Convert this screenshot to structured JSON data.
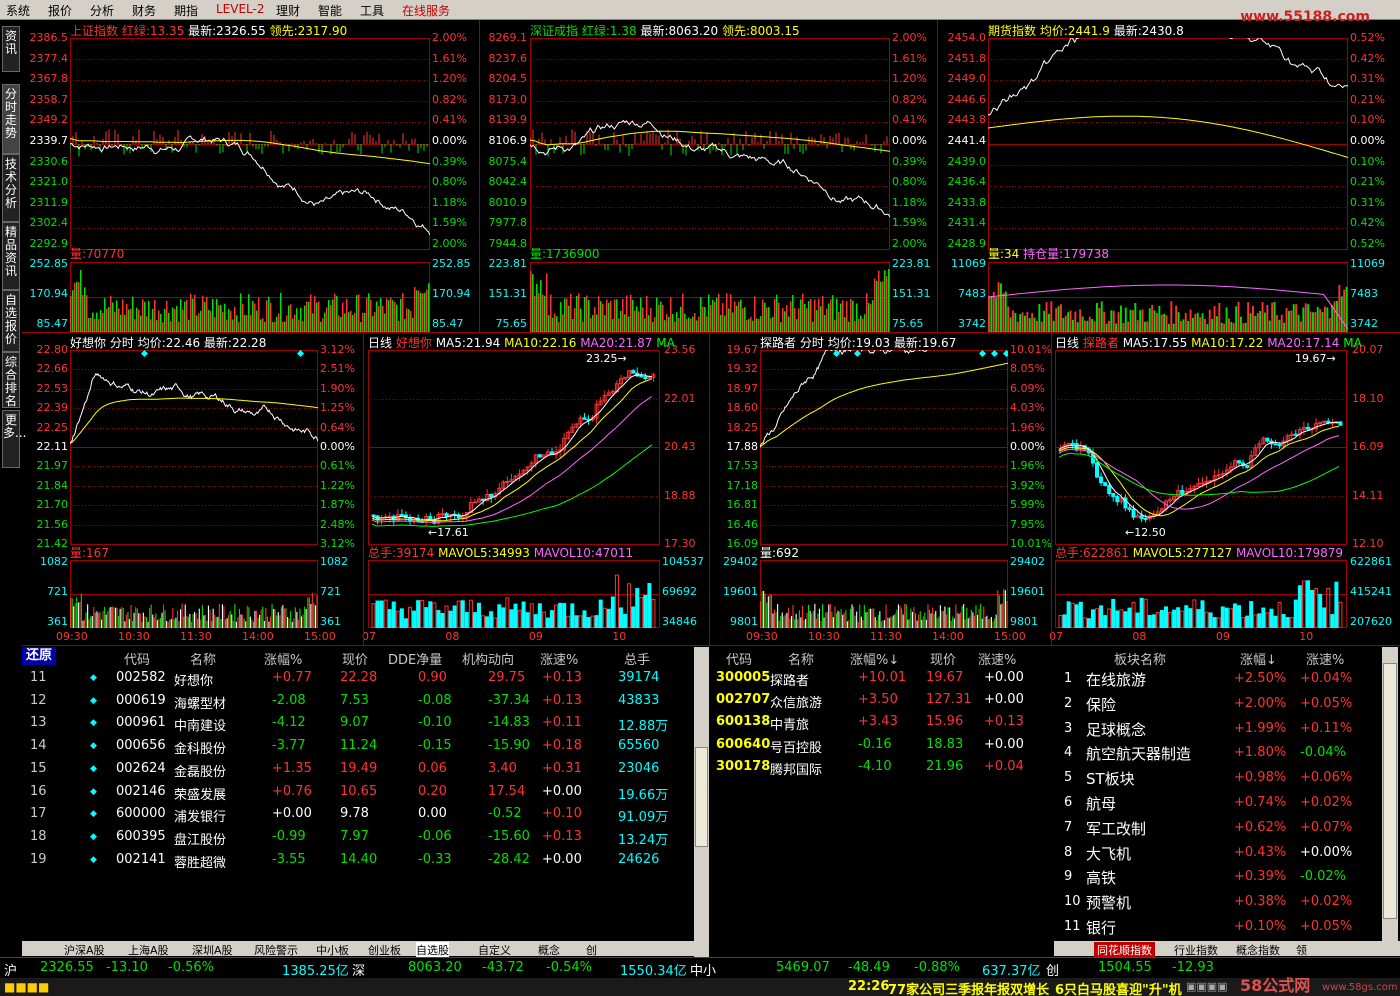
{
  "menu": [
    "系统",
    "报价",
    "分析",
    "财务",
    "期指",
    "LEVEL-2",
    "理财",
    "智能",
    "工具",
    "在线服务"
  ],
  "logo_text": "www.55188.com",
  "left_tabs": [
    "资讯",
    "分时走势",
    "技术分析",
    "精品资讯",
    "自选报价",
    "综合排名",
    "更多..."
  ],
  "colors": {
    "up": "#ff3232",
    "down": "#00e000",
    "axis": "#c00000",
    "white": "#ffffff",
    "yellow": "#ffff00",
    "cyan": "#00ffff",
    "magenta": "#ff00ff"
  },
  "p1": {
    "name": "上证指数",
    "red_green_label": "红绿:",
    "red_green": "13.35",
    "latest_label": "最新:",
    "latest": "2326.55",
    "lead_label": "领先:",
    "lead": "2317.90",
    "left_ticks": [
      "2386.5",
      "2377.4",
      "2367.8",
      "2358.7",
      "2349.2",
      "2339.7",
      "2330.6",
      "2321.0",
      "2311.9",
      "2302.4",
      "2292.9"
    ],
    "right_ticks": [
      "2.00%",
      "1.61%",
      "1.20%",
      "0.82%",
      "0.41%",
      "0.00%",
      "0.39%",
      "0.80%",
      "1.18%",
      "1.59%",
      "2.00%"
    ],
    "vol_label": "量:",
    "vol": "70770",
    "vol_ticks": [
      "252.85",
      "170.94",
      "85.47"
    ]
  },
  "p2": {
    "name": "深证成指",
    "red_green_label": "红绿:",
    "red_green": "1.38",
    "latest_label": "最新:",
    "latest": "8063.20",
    "lead_label": "领先:",
    "lead": "8003.15",
    "left_ticks": [
      "8269.1",
      "8237.6",
      "8204.5",
      "8173.0",
      "8139.9",
      "8106.9",
      "8075.4",
      "8042.4",
      "8010.9",
      "7977.8",
      "7944.8"
    ],
    "right_ticks": [
      "2.00%",
      "1.61%",
      "1.20%",
      "0.82%",
      "0.41%",
      "0.00%",
      "0.39%",
      "0.80%",
      "1.18%",
      "1.59%",
      "2.00%"
    ],
    "vol_label": "量:",
    "vol": "1736900",
    "vol_ticks": [
      "223.81",
      "151.31",
      "75.65"
    ]
  },
  "p3": {
    "name": "期货指数",
    "avg_label": "均价:",
    "avg": "2441.9",
    "latest_label": "最新:",
    "latest": "2430.8",
    "left_ticks": [
      "2454.0",
      "2451.8",
      "2449.0",
      "2446.6",
      "2443.8",
      "2441.4",
      "2439.0",
      "2436.4",
      "2433.8",
      "2431.4",
      "2428.9"
    ],
    "right_ticks": [
      "0.52%",
      "0.42%",
      "0.31%",
      "0.21%",
      "0.10%",
      "0.00%",
      "0.10%",
      "0.21%",
      "0.31%",
      "0.42%",
      "0.52%"
    ],
    "vol_label": "量:",
    "vol": "34",
    "oi_label": "持仓量:",
    "oi": "179738",
    "vol_ticks": [
      "11069",
      "7483",
      "3742"
    ]
  },
  "p4": {
    "name": "好想你",
    "kind": "分时",
    "avg_label": "均价:",
    "avg": "22.46",
    "latest_label": "最新:",
    "latest": "22.28",
    "left_ticks": [
      "22.80",
      "22.66",
      "22.53",
      "22.39",
      "22.25",
      "22.11",
      "21.97",
      "21.84",
      "21.70",
      "21.56",
      "21.42"
    ],
    "right_ticks": [
      "3.12%",
      "2.51%",
      "1.90%",
      "1.25%",
      "0.64%",
      "0.00%",
      "0.61%",
      "1.22%",
      "1.87%",
      "2.48%",
      "3.12%"
    ],
    "vol_label": "量:",
    "vol": "167",
    "vol_ticks": [
      "1082",
      "721",
      "361"
    ],
    "time_ticks": [
      "09:30",
      "10:30",
      "11:30",
      "14:00",
      "15:00"
    ]
  },
  "p5": {
    "kind": "日线",
    "name": "好想你",
    "ma5_label": "MA5:",
    "ma5": "21.94",
    "ma10_label": "MA10:",
    "ma10": "22.16",
    "ma20_label": "MA20:",
    "ma20": "21.87",
    "ma_tail": "MA",
    "right_ticks": [
      "23.56",
      "22.01",
      "20.43",
      "18.88",
      "17.30"
    ],
    "high_mark": "23.25",
    "low_mark": "17.61",
    "vol_label": "总手:",
    "vol": "39174",
    "mavol5_label": "MAVOL5:",
    "mavol5": "34993",
    "mavol10_label": "MAVOL10:",
    "mavol10": "47011",
    "vol_ticks": [
      "104537",
      "69692",
      "34846"
    ],
    "month_ticks": [
      "07",
      "08",
      "09",
      "10"
    ]
  },
  "p6": {
    "name": "探路者",
    "kind": "分时",
    "avg_label": "均价:",
    "avg": "19.03",
    "latest_label": "最新:",
    "latest": "19.67",
    "left_ticks": [
      "19.67",
      "19.32",
      "18.97",
      "18.60",
      "18.25",
      "17.88",
      "17.53",
      "17.18",
      "16.81",
      "16.46",
      "16.09"
    ],
    "right_ticks": [
      "10.01%",
      "8.05%",
      "6.09%",
      "4.03%",
      "1.96%",
      "0.00%",
      "1.96%",
      "3.92%",
      "5.99%",
      "7.95%",
      "10.01%"
    ],
    "vol_label": "量:",
    "vol": "692",
    "vol_ticks": [
      "29402",
      "19601",
      "9801"
    ],
    "time_ticks": [
      "09:30",
      "10:30",
      "11:30",
      "14:00",
      "15:00"
    ]
  },
  "p7": {
    "kind": "日线",
    "name": "探路者",
    "ma5_label": "MA5:",
    "ma5": "17.55",
    "ma10_label": "MA10:",
    "ma10": "17.22",
    "ma20_label": "MA20:",
    "ma20": "17.14",
    "ma_tail": "MA",
    "right_ticks": [
      "20.07",
      "18.10",
      "16.09",
      "14.11",
      "12.10"
    ],
    "high_mark": "19.67",
    "low_mark": "12.50",
    "vol_label": "总手:",
    "vol": "622861",
    "mavol5_label": "MAVOL5:",
    "mavol5": "277127",
    "mavol10_label": "MAVOL10:",
    "mavol10": "179879",
    "vol_ticks": [
      "622861",
      "415241",
      "207620"
    ],
    "month_ticks": [
      "07",
      "08",
      "09",
      "10"
    ]
  },
  "watch": {
    "restore_button": "还原",
    "headers": [
      "代码",
      "名称",
      "涨幅%",
      "现价",
      "DDE净量",
      "机构动向",
      "涨速%",
      "总手"
    ],
    "rows": [
      [
        "11",
        "002582",
        "好想你",
        "+0.77",
        "22.28",
        "0.90",
        "29.75",
        "+0.13",
        "39174"
      ],
      [
        "12",
        "000619",
        "海螺型材",
        "-2.08",
        "7.53",
        "-0.08",
        "-37.34",
        "+0.13",
        "43833"
      ],
      [
        "13",
        "000961",
        "中南建设",
        "-4.12",
        "9.07",
        "-0.10",
        "-14.83",
        "+0.11",
        "12.88万"
      ],
      [
        "14",
        "000656",
        "金科股份",
        "-3.77",
        "11.24",
        "-0.15",
        "-15.90",
        "+0.18",
        "65560"
      ],
      [
        "15",
        "002624",
        "金磊股份",
        "+1.35",
        "19.49",
        "0.06",
        "3.40",
        "+0.31",
        "23046"
      ],
      [
        "16",
        "002146",
        "荣盛发展",
        "+0.76",
        "10.65",
        "0.20",
        "17.54",
        "+0.00",
        "19.66万"
      ],
      [
        "17",
        "600000",
        "浦发银行",
        "+0.00",
        "9.78",
        "0.00",
        "-0.52",
        "+0.10",
        "91.09万"
      ],
      [
        "18",
        "600395",
        "盘江股份",
        "-0.99",
        "7.97",
        "-0.06",
        "-15.60",
        "+0.13",
        "13.24万"
      ],
      [
        "19",
        "002141",
        "蓉胜超微",
        "-3.55",
        "14.40",
        "-0.33",
        "-28.42",
        "+0.00",
        "24626"
      ]
    ]
  },
  "rank": {
    "headers": [
      "代码",
      "名称",
      "涨幅%",
      "现价",
      "涨速%"
    ],
    "sort_arrow": "↓",
    "rows": [
      [
        "300005",
        "探路者",
        "+10.01",
        "19.67",
        "+0.00"
      ],
      [
        "002707",
        "众信旅游",
        "+3.50",
        "127.31",
        "+0.00"
      ],
      [
        "600138",
        "中青旅",
        "+3.43",
        "15.96",
        "+0.13"
      ],
      [
        "600640",
        "号百控股",
        "-0.16",
        "18.83",
        "+0.00"
      ],
      [
        "300178",
        "腾邦国际",
        "-4.10",
        "21.96",
        "+0.04"
      ]
    ]
  },
  "sector": {
    "headers": [
      "板块名称",
      "涨幅",
      "涨速%"
    ],
    "sort_arrow": "↓",
    "rows": [
      [
        "1",
        "在线旅游",
        "+2.50%",
        "+0.04%"
      ],
      [
        "2",
        "保险",
        "+2.00%",
        "+0.05%"
      ],
      [
        "3",
        "足球概念",
        "+1.99%",
        "+0.11%"
      ],
      [
        "4",
        "航空航天器制造",
        "+1.80%",
        "-0.04%"
      ],
      [
        "5",
        "ST板块",
        "+0.98%",
        "+0.06%"
      ],
      [
        "6",
        "航母",
        "+0.74%",
        "+0.02%"
      ],
      [
        "7",
        "军工改制",
        "+0.62%",
        "+0.07%"
      ],
      [
        "8",
        "大飞机",
        "+0.43%",
        "+0.00%"
      ],
      [
        "9",
        "高铁",
        "+0.39%",
        "-0.02%"
      ],
      [
        "10",
        "预警机",
        "+0.38%",
        "+0.02%"
      ],
      [
        "11",
        "银行",
        "+0.10%",
        "+0.05%"
      ]
    ],
    "tabs": [
      "同花顺指数",
      "行业指数",
      "概念指数",
      "领"
    ]
  },
  "sheet_tabs": [
    "沪深A股",
    "上海A股",
    "深圳A股",
    "风险警示",
    "中小板",
    "创业板",
    "自选股",
    "自定义",
    "概念",
    "创"
  ],
  "status": {
    "sh_label": "沪",
    "sh_price": "2326.55",
    "sh_chg": "-13.10",
    "sh_pct": "-0.56%",
    "sh_amt": "1385.25亿",
    "sz_label": "深",
    "sz_price": "8063.20",
    "sz_chg": "-43.72",
    "sz_pct": "-0.54%",
    "sz_amt": "1550.34亿",
    "zx_label": "中小",
    "zx_price": "5469.07",
    "zx_chg": "-48.49",
    "zx_pct": "-0.88%",
    "zx_amt": "637.37亿",
    "cy_label": "创",
    "cy_price": "1504.55",
    "cy_chg": "-12.93"
  },
  "ticker": {
    "time": "22:26",
    "news1": "77家公司三季报年报双增长",
    "news2": "6只白马股喜迎\"升\"机",
    "site": "58公式网",
    "site_url": "www.58gs.com"
  }
}
